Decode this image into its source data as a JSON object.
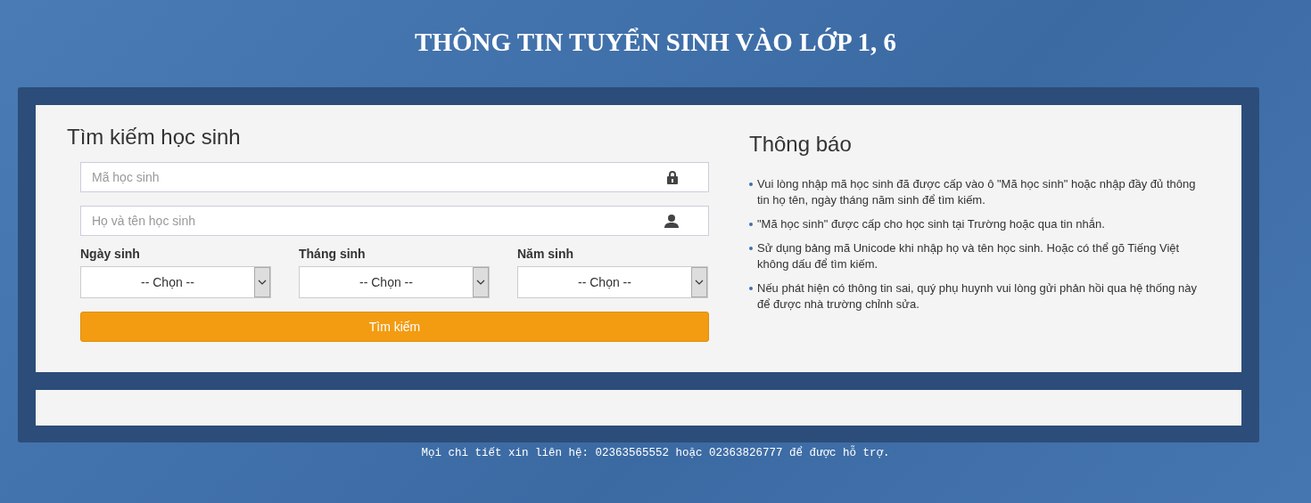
{
  "page_title": "THÔNG TIN TUYỂN SINH VÀO LỚP 1, 6",
  "search": {
    "heading": "Tìm kiếm học sinh",
    "fields": [
      {
        "kind": "lock",
        "placeholder": "Mã học sinh"
      },
      {
        "kind": "person",
        "placeholder": "Họ và tên học sinh"
      }
    ],
    "selects": [
      {
        "label": "Ngày sinh",
        "value": "-- Chọn --"
      },
      {
        "label": "Tháng sinh",
        "value": "-- Chọn --"
      },
      {
        "label": "Năm sinh",
        "value": "-- Chọn --"
      }
    ],
    "button": "Tìm kiếm"
  },
  "notice": {
    "heading": "Thông báo",
    "items": [
      "Vui lòng nhập mã học sinh đã được cấp vào ô \"Mã học sinh\" hoặc nhập đầy đủ thông tin họ tên, ngày tháng năm sinh để tìm kiếm.",
      "\"Mã học sinh\" được cấp cho học sinh tại Trường hoặc qua tin nhắn.",
      "Sử dụng bảng mã Unicode khi nhập họ và tên học sinh. Hoặc có thể gõ Tiếng Việt không dấu để tìm kiếm.",
      "Nếu phát hiện có thông tin sai, quý phụ huynh vui lòng gửi phản hồi qua hệ thống này để được nhà trường chỉnh sửa."
    ]
  },
  "footer": "Mọi chi tiết xin liên hệ: 02363565552 hoặc 02363826777 để được hỗ trợ."
}
